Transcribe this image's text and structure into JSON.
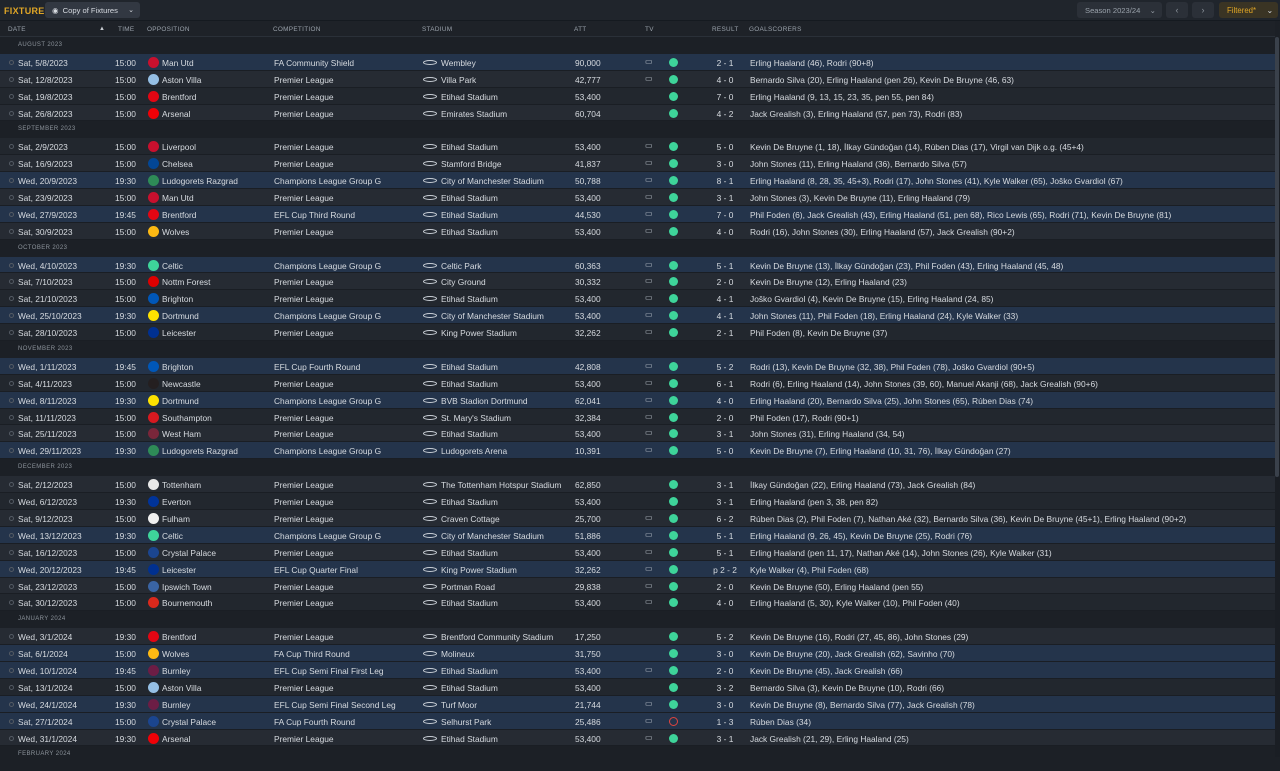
{
  "toolbar": {
    "title": "FIXTURES",
    "view_label": "Copy of Fixtures",
    "season_label": "Season 2023/24",
    "filter_label": "Filtered*"
  },
  "columns": {
    "date": "DATE",
    "time": "TIME",
    "opposition": "OPPOSITION",
    "competition": "COMPETITION",
    "stadium": "STADIUM",
    "att": "ATT",
    "tv": "TV",
    "result": "RESULT",
    "goalscorers": "GOALSCORERS"
  },
  "colors": {
    "accent": "#e0a626",
    "win": "#3ed49a",
    "loss": "#e0443e",
    "highlight_row": "#24344b"
  },
  "icons": {
    "tv": "tv-icon",
    "stadium": "stadium-icon",
    "result_win": "win-dot-icon",
    "result_loss": "loss-ring-icon"
  },
  "months": [
    {
      "label": "AUGUST 2023",
      "fixtures": [
        {
          "date": "Sat, 5/8/2023",
          "time": "15:00",
          "opp": "Man Utd",
          "crest": "#c8102e",
          "comp": "FA Community Shield",
          "stadium": "Wembley",
          "att": "90,000",
          "tv": true,
          "outcome": "win",
          "score": "2 - 1",
          "scorers": "Erling Haaland (46), Rodri (90+8)",
          "hl": true
        },
        {
          "date": "Sat, 12/8/2023",
          "time": "15:00",
          "opp": "Aston Villa",
          "crest": "#95bfe5",
          "comp": "Premier League",
          "stadium": "Villa Park",
          "att": "42,777",
          "tv": true,
          "outcome": "win",
          "score": "4 - 0",
          "scorers": "Bernardo Silva (20), Erling Haaland (pen 26), Kevin De Bruyne (46, 63)",
          "hl": false
        },
        {
          "date": "Sat, 19/8/2023",
          "time": "15:00",
          "opp": "Brentford",
          "crest": "#e30613",
          "comp": "Premier League",
          "stadium": "Etihad Stadium",
          "att": "53,400",
          "tv": false,
          "outcome": "win",
          "score": "7 - 0",
          "scorers": "Erling Haaland (9, 13, 15, 23, 35, pen 55, pen 84)",
          "hl": false
        },
        {
          "date": "Sat, 26/8/2023",
          "time": "15:00",
          "opp": "Arsenal",
          "crest": "#ef0107",
          "comp": "Premier League",
          "stadium": "Emirates Stadium",
          "att": "60,704",
          "tv": false,
          "outcome": "win",
          "score": "4 - 2",
          "scorers": "Jack Grealish (3), Erling Haaland (57, pen 73), Rodri (83)",
          "hl": false
        }
      ]
    },
    {
      "label": "SEPTEMBER 2023",
      "fixtures": [
        {
          "date": "Sat, 2/9/2023",
          "time": "15:00",
          "opp": "Liverpool",
          "crest": "#c8102e",
          "comp": "Premier League",
          "stadium": "Etihad Stadium",
          "att": "53,400",
          "tv": true,
          "outcome": "win",
          "score": "5 - 0",
          "scorers": "Kevin De Bruyne (1, 18), İlkay Gündoğan (14), Rúben Dias (17), Virgil van Dijk o.g. (45+4)",
          "hl": false
        },
        {
          "date": "Sat, 16/9/2023",
          "time": "15:00",
          "opp": "Chelsea",
          "crest": "#034694",
          "comp": "Premier League",
          "stadium": "Stamford Bridge",
          "att": "41,837",
          "tv": true,
          "outcome": "win",
          "score": "3 - 0",
          "scorers": "John Stones (11), Erling Haaland (36), Bernardo Silva (57)",
          "hl": false
        },
        {
          "date": "Wed, 20/9/2023",
          "time": "19:30",
          "opp": "Ludogorets Razgrad",
          "crest": "#2e8b57",
          "comp": "Champions League Group G",
          "stadium": "City of Manchester Stadium",
          "att": "50,788",
          "tv": true,
          "outcome": "win",
          "score": "8 - 1",
          "scorers": "Erling Haaland (8, 28, 35, 45+3), Rodri (17), John Stones (41), Kyle Walker (65), Joško Gvardiol (67)",
          "hl": true
        },
        {
          "date": "Sat, 23/9/2023",
          "time": "15:00",
          "opp": "Man Utd",
          "crest": "#c8102e",
          "comp": "Premier League",
          "stadium": "Etihad Stadium",
          "att": "53,400",
          "tv": true,
          "outcome": "win",
          "score": "3 - 1",
          "scorers": "John Stones (3), Kevin De Bruyne (11), Erling Haaland (79)",
          "hl": false
        },
        {
          "date": "Wed, 27/9/2023",
          "time": "19:45",
          "opp": "Brentford",
          "crest": "#e30613",
          "comp": "EFL Cup Third Round",
          "stadium": "Etihad Stadium",
          "att": "44,530",
          "tv": true,
          "outcome": "win",
          "score": "7 - 0",
          "scorers": "Phil Foden (6), Jack Grealish (43), Erling Haaland (51, pen 68), Rico Lewis (65), Rodri (71), Kevin De Bruyne (81)",
          "hl": true
        },
        {
          "date": "Sat, 30/9/2023",
          "time": "15:00",
          "opp": "Wolves",
          "crest": "#fdb913",
          "comp": "Premier League",
          "stadium": "Etihad Stadium",
          "att": "53,400",
          "tv": true,
          "outcome": "win",
          "score": "4 - 0",
          "scorers": "Rodri (16), John Stones (30), Erling Haaland (57), Jack Grealish (90+2)",
          "hl": false
        }
      ]
    },
    {
      "label": "OCTOBER 2023",
      "fixtures": [
        {
          "date": "Wed, 4/10/2023",
          "time": "19:30",
          "opp": "Celtic",
          "crest": "#3ed49a",
          "comp": "Champions League Group G",
          "stadium": "Celtic Park",
          "att": "60,363",
          "tv": true,
          "outcome": "win",
          "score": "5 - 1",
          "scorers": "Kevin De Bruyne (13), İlkay Gündoğan (23), Phil Foden (43), Erling Haaland (45, 48)",
          "hl": true
        },
        {
          "date": "Sat, 7/10/2023",
          "time": "15:00",
          "opp": "Nottm Forest",
          "crest": "#dd0000",
          "comp": "Premier League",
          "stadium": "City Ground",
          "att": "30,332",
          "tv": true,
          "outcome": "win",
          "score": "2 - 0",
          "scorers": "Kevin De Bruyne (12), Erling Haaland (23)",
          "hl": false
        },
        {
          "date": "Sat, 21/10/2023",
          "time": "15:00",
          "opp": "Brighton",
          "crest": "#0057b8",
          "comp": "Premier League",
          "stadium": "Etihad Stadium",
          "att": "53,400",
          "tv": true,
          "outcome": "win",
          "score": "4 - 1",
          "scorers": "Joško Gvardiol (4), Kevin De Bruyne (15), Erling Haaland (24, 85)",
          "hl": false
        },
        {
          "date": "Wed, 25/10/2023",
          "time": "19:30",
          "opp": "Dortmund",
          "crest": "#fde100",
          "comp": "Champions League Group G",
          "stadium": "City of Manchester Stadium",
          "att": "53,400",
          "tv": true,
          "outcome": "win",
          "score": "4 - 1",
          "scorers": "John Stones (11), Phil Foden (18), Erling Haaland (24), Kyle Walker (33)",
          "hl": true
        },
        {
          "date": "Sat, 28/10/2023",
          "time": "15:00",
          "opp": "Leicester",
          "crest": "#003090",
          "comp": "Premier League",
          "stadium": "King Power Stadium",
          "att": "32,262",
          "tv": true,
          "outcome": "win",
          "score": "2 - 1",
          "scorers": "Phil Foden (8), Kevin De Bruyne (37)",
          "hl": false
        }
      ]
    },
    {
      "label": "NOVEMBER 2023",
      "fixtures": [
        {
          "date": "Wed, 1/11/2023",
          "time": "19:45",
          "opp": "Brighton",
          "crest": "#0057b8",
          "comp": "EFL Cup Fourth Round",
          "stadium": "Etihad Stadium",
          "att": "42,808",
          "tv": true,
          "outcome": "win",
          "score": "5 - 2",
          "scorers": "Rodri (13), Kevin De Bruyne (32, 38), Phil Foden (78), Joško Gvardiol (90+5)",
          "hl": true
        },
        {
          "date": "Sat, 4/11/2023",
          "time": "15:00",
          "opp": "Newcastle",
          "crest": "#241f20",
          "comp": "Premier League",
          "stadium": "Etihad Stadium",
          "att": "53,400",
          "tv": true,
          "outcome": "win",
          "score": "6 - 1",
          "scorers": "Rodri (6), Erling Haaland (14), John Stones (39, 60), Manuel Akanji (68), Jack Grealish (90+6)",
          "hl": false
        },
        {
          "date": "Wed, 8/11/2023",
          "time": "19:30",
          "opp": "Dortmund",
          "crest": "#fde100",
          "comp": "Champions League Group G",
          "stadium": "BVB Stadion Dortmund",
          "att": "62,041",
          "tv": true,
          "outcome": "win",
          "score": "4 - 0",
          "scorers": "Erling Haaland (20), Bernardo Silva (25), John Stones (65), Rúben Dias (74)",
          "hl": true
        },
        {
          "date": "Sat, 11/11/2023",
          "time": "15:00",
          "opp": "Southampton",
          "crest": "#d71920",
          "comp": "Premier League",
          "stadium": "St. Mary's Stadium",
          "att": "32,384",
          "tv": true,
          "outcome": "win",
          "score": "2 - 0",
          "scorers": "Phil Foden (17), Rodri (90+1)",
          "hl": false
        },
        {
          "date": "Sat, 25/11/2023",
          "time": "15:00",
          "opp": "West Ham",
          "crest": "#7a263a",
          "comp": "Premier League",
          "stadium": "Etihad Stadium",
          "att": "53,400",
          "tv": true,
          "outcome": "win",
          "score": "3 - 1",
          "scorers": "John Stones (31), Erling Haaland (34, 54)",
          "hl": false
        },
        {
          "date": "Wed, 29/11/2023",
          "time": "19:30",
          "opp": "Ludogorets Razgrad",
          "crest": "#2e8b57",
          "comp": "Champions League Group G",
          "stadium": "Ludogorets Arena",
          "att": "10,391",
          "tv": true,
          "outcome": "win",
          "score": "5 - 0",
          "scorers": "Kevin De Bruyne (7), Erling Haaland (10, 31, 76), İlkay Gündoğan (27)",
          "hl": true
        }
      ]
    },
    {
      "label": "DECEMBER 2023",
      "fixtures": [
        {
          "date": "Sat, 2/12/2023",
          "time": "15:00",
          "opp": "Tottenham",
          "crest": "#e8e8e8",
          "comp": "Premier League",
          "stadium": "The Tottenham Hotspur Stadium",
          "att": "62,850",
          "tv": false,
          "outcome": "win",
          "score": "3 - 1",
          "scorers": "İlkay Gündoğan (22), Erling Haaland (73), Jack Grealish (84)",
          "hl": false
        },
        {
          "date": "Wed, 6/12/2023",
          "time": "19:30",
          "opp": "Everton",
          "crest": "#003399",
          "comp": "Premier League",
          "stadium": "Etihad Stadium",
          "att": "53,400",
          "tv": false,
          "outcome": "win",
          "score": "3 - 1",
          "scorers": "Erling Haaland (pen 3, 38, pen 82)",
          "hl": false
        },
        {
          "date": "Sat, 9/12/2023",
          "time": "15:00",
          "opp": "Fulham",
          "crest": "#f0f0f0",
          "comp": "Premier League",
          "stadium": "Craven Cottage",
          "att": "25,700",
          "tv": true,
          "outcome": "win",
          "score": "6 - 2",
          "scorers": "Rúben Dias (2), Phil Foden (7), Nathan Aké (32), Bernardo Silva (36), Kevin De Bruyne (45+1), Erling Haaland (90+2)",
          "hl": false
        },
        {
          "date": "Wed, 13/12/2023",
          "time": "19:30",
          "opp": "Celtic",
          "crest": "#3ed49a",
          "comp": "Champions League Group G",
          "stadium": "City of Manchester Stadium",
          "att": "51,886",
          "tv": true,
          "outcome": "win",
          "score": "5 - 1",
          "scorers": "Erling Haaland (9, 26, 45), Kevin De Bruyne (25), Rodri (76)",
          "hl": true
        },
        {
          "date": "Sat, 16/12/2023",
          "time": "15:00",
          "opp": "Crystal Palace",
          "crest": "#1b458f",
          "comp": "Premier League",
          "stadium": "Etihad Stadium",
          "att": "53,400",
          "tv": true,
          "outcome": "win",
          "score": "5 - 1",
          "scorers": "Erling Haaland (pen 11, 17), Nathan Aké (14), John Stones (26), Kyle Walker (31)",
          "hl": false
        },
        {
          "date": "Wed, 20/12/2023",
          "time": "19:45",
          "opp": "Leicester",
          "crest": "#003090",
          "comp": "EFL Cup Quarter Final",
          "stadium": "King Power Stadium",
          "att": "32,262",
          "tv": true,
          "outcome": "win",
          "score": "p 2 - 2",
          "scorers": "Kyle Walker (4), Phil Foden (68)",
          "hl": true
        },
        {
          "date": "Sat, 23/12/2023",
          "time": "15:00",
          "opp": "Ipswich Town",
          "crest": "#3a64a3",
          "comp": "Premier League",
          "stadium": "Portman Road",
          "att": "29,838",
          "tv": true,
          "outcome": "win",
          "score": "2 - 0",
          "scorers": "Kevin De Bruyne (50), Erling Haaland (pen 55)",
          "hl": false
        },
        {
          "date": "Sat, 30/12/2023",
          "time": "15:00",
          "opp": "Bournemouth",
          "crest": "#da291c",
          "comp": "Premier League",
          "stadium": "Etihad Stadium",
          "att": "53,400",
          "tv": true,
          "outcome": "win",
          "score": "4 - 0",
          "scorers": "Erling Haaland (5, 30), Kyle Walker (10), Phil Foden (40)",
          "hl": false
        }
      ]
    },
    {
      "label": "JANUARY 2024",
      "fixtures": [
        {
          "date": "Wed, 3/1/2024",
          "time": "19:30",
          "opp": "Brentford",
          "crest": "#e30613",
          "comp": "Premier League",
          "stadium": "Brentford Community Stadium",
          "att": "17,250",
          "tv": false,
          "outcome": "win",
          "score": "5 - 2",
          "scorers": "Kevin De Bruyne (16), Rodri (27, 45, 86), John Stones (29)",
          "hl": false
        },
        {
          "date": "Sat, 6/1/2024",
          "time": "15:00",
          "opp": "Wolves",
          "crest": "#fdb913",
          "comp": "FA Cup Third Round",
          "stadium": "Molineux",
          "att": "31,750",
          "tv": false,
          "outcome": "win",
          "score": "3 - 0",
          "scorers": "Kevin De Bruyne (20), Jack Grealish (62), Savinho (70)",
          "hl": true
        },
        {
          "date": "Wed, 10/1/2024",
          "time": "19:45",
          "opp": "Burnley",
          "crest": "#6c1d45",
          "comp": "EFL Cup Semi Final First Leg",
          "stadium": "Etihad Stadium",
          "att": "53,400",
          "tv": true,
          "outcome": "win",
          "score": "2 - 0",
          "scorers": "Kevin De Bruyne (45), Jack Grealish (66)",
          "hl": true
        },
        {
          "date": "Sat, 13/1/2024",
          "time": "15:00",
          "opp": "Aston Villa",
          "crest": "#95bfe5",
          "comp": "Premier League",
          "stadium": "Etihad Stadium",
          "att": "53,400",
          "tv": false,
          "outcome": "win",
          "score": "3 - 2",
          "scorers": "Bernardo Silva (3), Kevin De Bruyne (10), Rodri (66)",
          "hl": false
        },
        {
          "date": "Wed, 24/1/2024",
          "time": "19:30",
          "opp": "Burnley",
          "crest": "#6c1d45",
          "comp": "EFL Cup Semi Final Second Leg",
          "stadium": "Turf Moor",
          "att": "21,744",
          "tv": true,
          "outcome": "win",
          "score": "3 - 0",
          "scorers": "Kevin De Bruyne (8), Bernardo Silva (77), Jack Grealish (78)",
          "hl": true
        },
        {
          "date": "Sat, 27/1/2024",
          "time": "15:00",
          "opp": "Crystal Palace",
          "crest": "#1b458f",
          "comp": "FA Cup Fourth Round",
          "stadium": "Selhurst Park",
          "att": "25,486",
          "tv": true,
          "outcome": "loss",
          "score": "1 - 3",
          "scorers": "Rúben Dias (34)",
          "hl": true
        },
        {
          "date": "Wed, 31/1/2024",
          "time": "19:30",
          "opp": "Arsenal",
          "crest": "#ef0107",
          "comp": "Premier League",
          "stadium": "Etihad Stadium",
          "att": "53,400",
          "tv": true,
          "outcome": "win",
          "score": "3 - 1",
          "scorers": "Jack Grealish (21, 29), Erling Haaland (25)",
          "hl": false
        }
      ]
    },
    {
      "label": "FEBRUARY 2024",
      "fixtures": []
    }
  ]
}
